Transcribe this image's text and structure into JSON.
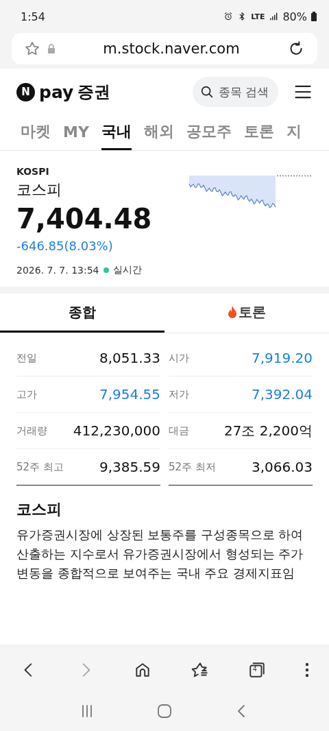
{
  "status_bar": {
    "time": "1:54",
    "battery": "80%",
    "network": "LTE"
  },
  "browser": {
    "url": "m.stock.naver.com",
    "tab_count": "4"
  },
  "header": {
    "logo_mark": "N",
    "logo_pay": "pay",
    "logo_title": "증권",
    "search_placeholder": "종목 검색"
  },
  "nav_tabs": [
    {
      "label": "마켓",
      "selected": false
    },
    {
      "label": "MY",
      "selected": false
    },
    {
      "label": "국내",
      "selected": true
    },
    {
      "label": "해외",
      "selected": false
    },
    {
      "label": "공모주",
      "selected": false
    },
    {
      "label": "토론",
      "selected": false
    },
    {
      "label": "지",
      "selected": false
    }
  ],
  "index": {
    "code": "KOSPI",
    "name": "코스피",
    "price": "7,404.48",
    "change": "-646.85(8.03%)",
    "timestamp": "2026. 7. 7. 13:54",
    "live_label": "실시간",
    "live": true
  },
  "section_tabs": [
    {
      "label": "종합",
      "selected": true,
      "kind": "plain"
    },
    {
      "label": "토론",
      "selected": false,
      "kind": "fire"
    }
  ],
  "stats": [
    {
      "label": "전일",
      "value": "8,051.33",
      "color": "#111111"
    },
    {
      "label": "시가",
      "value": "7,919.20",
      "color": "#1d7fe0"
    },
    {
      "label": "고가",
      "value": "7,954.55",
      "color": "#1d7fe0"
    },
    {
      "label": "저가",
      "value": "7,392.04",
      "color": "#1d7fe0"
    },
    {
      "label": "거래량",
      "value": "412,230,000",
      "color": "#111111"
    },
    {
      "label": "대금",
      "value": "27조 2,200억",
      "color": "#111111"
    },
    {
      "label": "52주 최고",
      "value": "9,385.59",
      "color": "#111111"
    },
    {
      "label": "52주 최저",
      "value": "3,066.03",
      "color": "#111111"
    }
  ],
  "description": {
    "title": "코스피",
    "text": "유가증권시장에 상장된 보통주를 구성종목으로 하여 산출하는 지수로서 유가증권시장에서 형성되는 주가변동을 종합적으로 보여주는 국내 주요 경제지표임"
  }
}
